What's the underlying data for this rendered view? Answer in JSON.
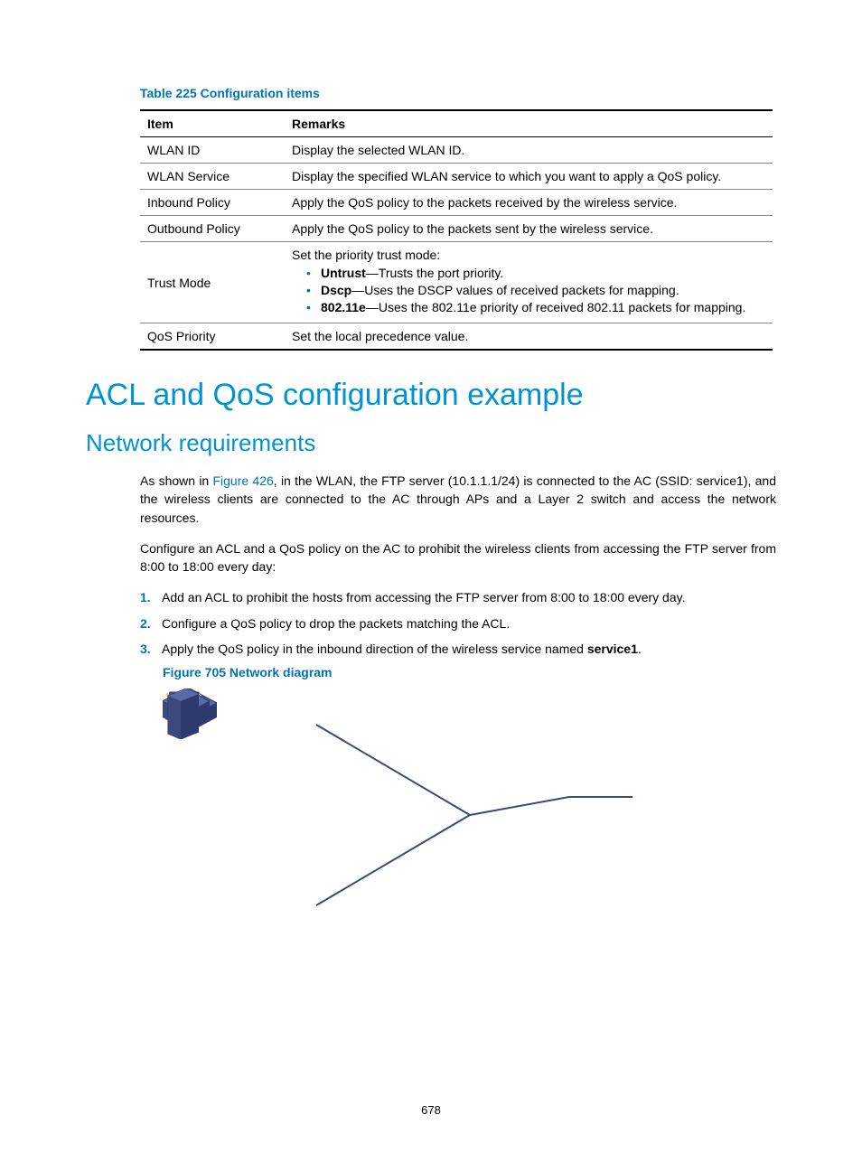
{
  "table": {
    "caption": "Table 225 Configuration items",
    "headers": {
      "item": "Item",
      "remarks": "Remarks"
    },
    "rows": [
      {
        "item": "WLAN ID",
        "remarks": "Display the selected WLAN ID."
      },
      {
        "item": "WLAN Service",
        "remarks": "Display the specified WLAN service to which you want to apply a QoS policy."
      },
      {
        "item": "Inbound Policy",
        "remarks": "Apply the QoS policy to the packets received by the wireless service."
      },
      {
        "item": "Outbound Policy",
        "remarks": "Apply the QoS policy to the packets sent by the wireless service."
      }
    ],
    "trust_row": {
      "item": "Trust Mode",
      "intro": "Set the priority trust mode:",
      "bullets": [
        {
          "b": "Untrust",
          "t": "—Trusts the port priority."
        },
        {
          "b": "Dscp",
          "t": "—Uses the DSCP values of received packets for mapping."
        },
        {
          "b": "802.11e",
          "t": "—Uses the 802.11e priority of received 802.11 packets for mapping."
        }
      ]
    },
    "qos_row": {
      "item": "QoS Priority",
      "remarks": "Set the local precedence value."
    }
  },
  "headings": {
    "h1": "ACL and QoS configuration example",
    "h2": "Network requirements"
  },
  "paragraphs": {
    "p1a": "As shown in ",
    "p1_link": "Figure 426",
    "p1b": ", in the WLAN, the FTP server (10.1.1.1/24) is connected to the AC (SSID: service1), and the wireless clients are connected to the AC through APs and a Layer 2 switch and access the network resources.",
    "p2": "Configure an ACL and a QoS policy on the AC to prohibit the wireless clients from accessing the FTP server from 8:00 to 18:00 every day:"
  },
  "list": {
    "n1": "1.",
    "t1": "Add an ACL to prohibit the hosts from accessing the FTP server from 8:00 to 18:00 every day.",
    "n2": "2.",
    "t2": "Configure a QoS policy to drop the packets matching the ACL.",
    "n3": "3.",
    "t3a": "Apply the QoS policy in the inbound direction of the wireless service named ",
    "t3b": "service1",
    "t3c": "."
  },
  "figure_caption": "Figure 705 Network diagram",
  "page_number": "678"
}
